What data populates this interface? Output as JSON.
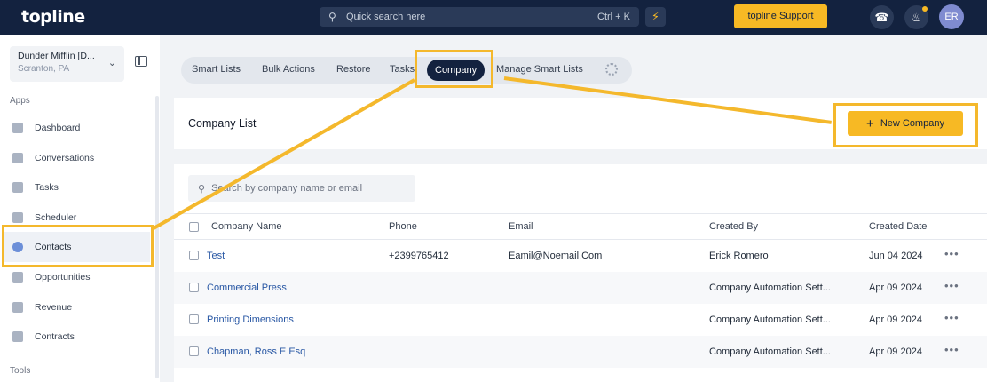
{
  "app": {
    "logo": "topline"
  },
  "topbar": {
    "search_placeholder": "Quick search here",
    "search_shortcut": "Ctrl + K",
    "support_label": "topline Support",
    "avatar_initials": "ER"
  },
  "sidebar": {
    "account_name": "Dunder Mifflin [D...",
    "account_location": "Scranton, PA",
    "section_apps": "Apps",
    "section_tools": "Tools",
    "items": [
      {
        "label": "Dashboard"
      },
      {
        "label": "Conversations"
      },
      {
        "label": "Tasks"
      },
      {
        "label": "Scheduler"
      },
      {
        "label": "Contacts"
      },
      {
        "label": "Opportunities"
      },
      {
        "label": "Revenue"
      },
      {
        "label": "Contracts"
      }
    ],
    "active_item": "Contacts"
  },
  "tabs": [
    {
      "label": "Smart Lists"
    },
    {
      "label": "Bulk Actions"
    },
    {
      "label": "Restore"
    },
    {
      "label": "Tasks"
    },
    {
      "label": "Company"
    },
    {
      "label": "Manage Smart Lists"
    }
  ],
  "active_tab": "Company",
  "page": {
    "title": "Company List",
    "new_button": "New Company",
    "table_search_placeholder": "Search by company name or email"
  },
  "table": {
    "columns": [
      "Company Name",
      "Phone",
      "Email",
      "Created By",
      "Created Date"
    ],
    "rows": [
      {
        "name": "Test",
        "phone": "+2399765412",
        "email": "Eamil@Noemail.Com",
        "created_by": "Erick Romero",
        "date": "Jun 04 2024"
      },
      {
        "name": "Commercial Press",
        "phone": "",
        "email": "",
        "created_by": "Company Automation Sett...",
        "date": "Apr 09 2024"
      },
      {
        "name": "Printing Dimensions",
        "phone": "",
        "email": "",
        "created_by": "Company Automation Sett...",
        "date": "Apr 09 2024"
      },
      {
        "name": "Chapman, Ross E Esq",
        "phone": "",
        "email": "",
        "created_by": "Company Automation Sett...",
        "date": "Apr 09 2024"
      }
    ]
  },
  "colors": {
    "topbar": "#13223f",
    "accent": "#f7b924",
    "link": "#2857a4",
    "annotation": "#f4b82c"
  }
}
